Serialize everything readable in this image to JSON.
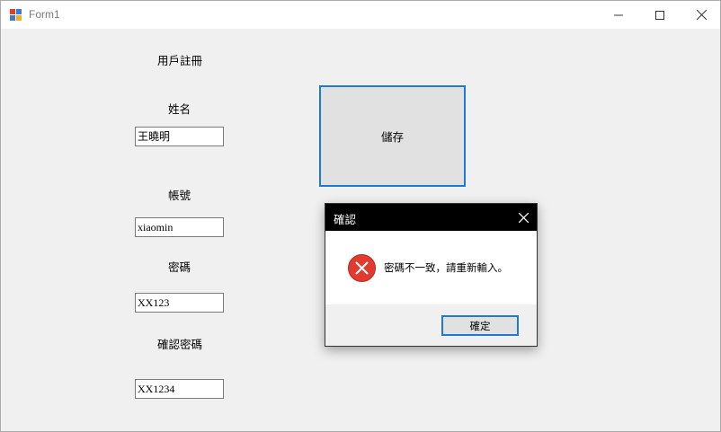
{
  "window": {
    "title": "Form1",
    "controls": {
      "minimize_icon": "minimize-icon",
      "maximize_icon": "maximize-icon",
      "close_icon": "close-icon"
    }
  },
  "form": {
    "heading": "用戶註冊",
    "fields": {
      "name": {
        "label": "姓名",
        "value": "王曉明"
      },
      "account": {
        "label": "帳號",
        "value": "xiaomin"
      },
      "password": {
        "label": "密碼",
        "value": "XX123"
      },
      "confirm_password": {
        "label": "確認密碼",
        "value": "XX1234"
      }
    },
    "save_button": "儲存"
  },
  "dialog": {
    "title": "確認",
    "message": "密碼不一致，請重新輸入。",
    "ok_button": "確定",
    "icon": "error-icon"
  },
  "colors": {
    "accent": "#1f7ad4",
    "error": "#e23a2e",
    "window_bg": "#f0f0f0"
  }
}
